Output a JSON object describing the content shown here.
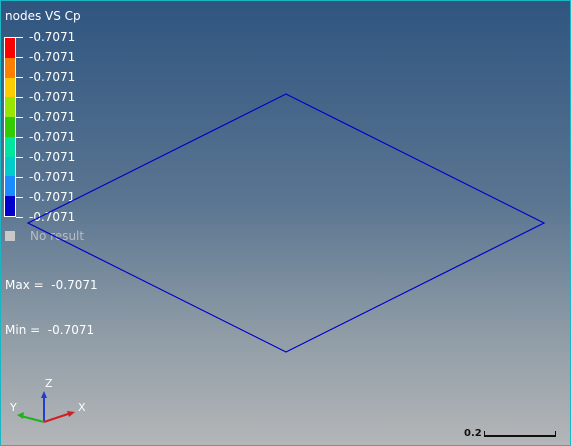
{
  "legend": {
    "title": "nodes VS Cp",
    "labels": [
      "-0.7071",
      "-0.7071",
      "-0.7071",
      "-0.7071",
      "-0.7071",
      "-0.7071",
      "-0.7071",
      "-0.7071",
      "-0.7071",
      "-0.7071"
    ],
    "colors": [
      "#ff0000",
      "#ff7f00",
      "#ffcc00",
      "#99e600",
      "#33cc00",
      "#00e5a0",
      "#00cccc",
      "#1a8cff",
      "#0000cc"
    ],
    "no_result_label": "No result",
    "no_result_color": "#c8c8c8"
  },
  "stats": {
    "max": "Max =  -0.7071",
    "min": "Min =  -0.7071"
  },
  "model": {
    "edge_color": "#0000cc"
  },
  "triad": {
    "x_label": "X",
    "y_label": "Y",
    "z_label": "Z"
  },
  "scale": {
    "label": "0.2"
  }
}
